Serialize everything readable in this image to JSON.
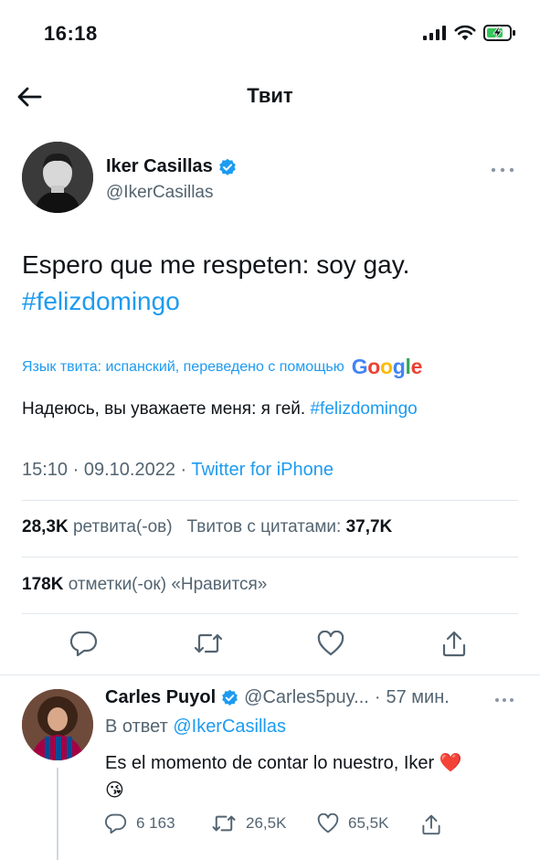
{
  "status_bar": {
    "time": "16:18",
    "icons": [
      "signal-icon",
      "wifi-icon",
      "battery-charging-icon"
    ]
  },
  "nav": {
    "title": "Твит",
    "back_icon": "arrow-left-icon"
  },
  "tweet": {
    "author_name": "Iker Casillas",
    "author_handle": "@IkerCasillas",
    "verified": true,
    "text_main": "Espero que me respeten: soy gay.",
    "hashtag": "#felizdomingo",
    "translation_note": "Язык твита: испанский, переведено с помощью",
    "translation_provider": "Google",
    "translated_text": "Надеюсь, вы уважаете меня: я гей.",
    "translated_hashtag": "#felizdomingo",
    "time": "15:10",
    "date": "09.10.2022",
    "source": "Twitter for iPhone",
    "retweets_count": "28,3K",
    "retweets_label": "ретвита(-ов)",
    "quotes_label": "Твитов с цитатами:",
    "quotes_count": "37,7K",
    "likes_count": "178K",
    "likes_label": "отметки(-ок) «Нравится»"
  },
  "reply": {
    "author_name": "Carles Puyol",
    "verified": true,
    "handle_truncated": "@Carles5puy...",
    "age": "57 мин.",
    "in_reply_prefix": "В ответ",
    "in_reply_mention": "@IkerCasillas",
    "text": "Es el momento de contar lo nuestro, Iker",
    "emoji_heart": "❤️",
    "emoji_kiss": "😘",
    "replies": "6 163",
    "retweets": "26,5K",
    "likes": "65,5K"
  },
  "colors": {
    "accent": "#1d9bf0",
    "secondary_text": "#536471",
    "divider": "#e1e8ed"
  }
}
